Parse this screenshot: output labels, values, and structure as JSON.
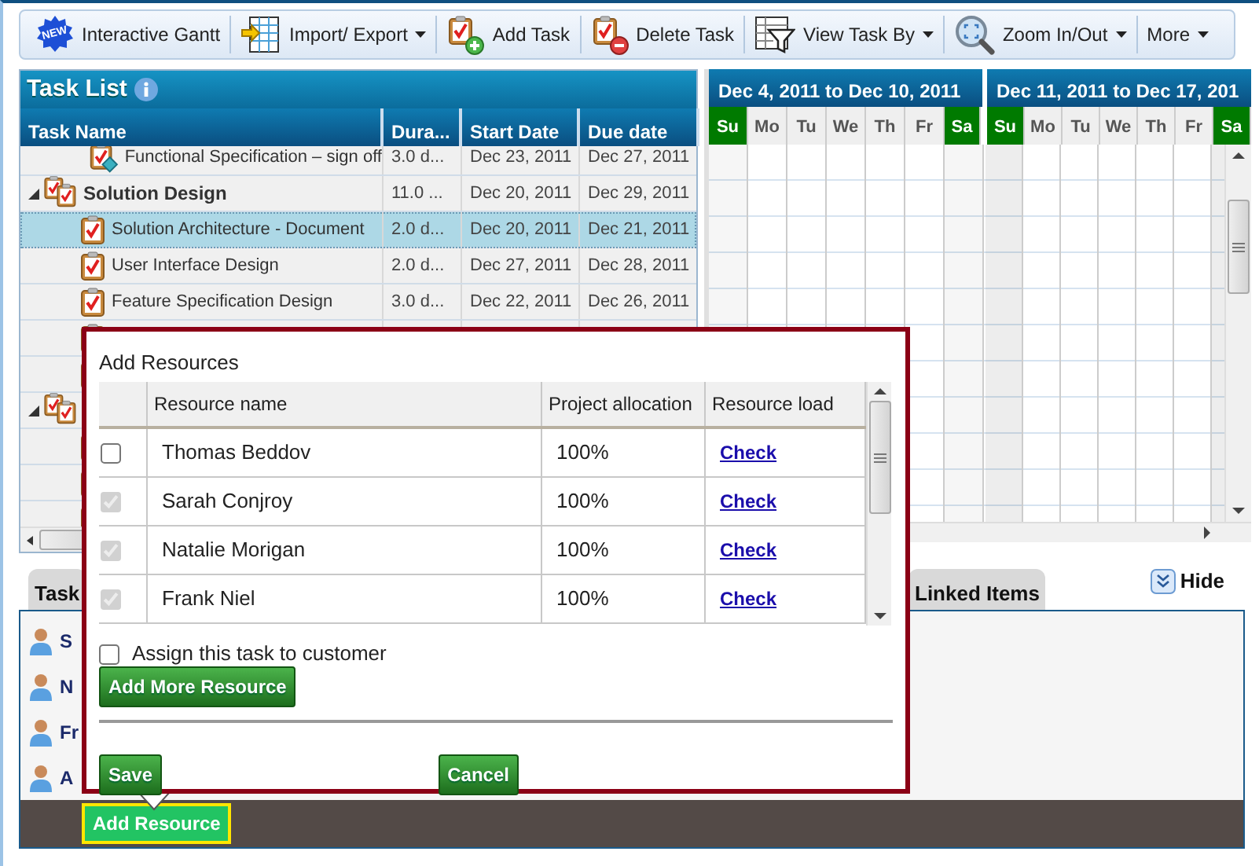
{
  "toolbar": [
    {
      "label": "Interactive Gantt",
      "kind": "new",
      "badge": "NEW",
      "dropdown": false
    },
    {
      "label": "Import/ Export",
      "kind": "import",
      "dropdown": true
    },
    {
      "label": "Add Task",
      "kind": "add",
      "dropdown": false
    },
    {
      "label": "Delete Task",
      "kind": "delete",
      "dropdown": false
    },
    {
      "label": "View Task By",
      "kind": "filter",
      "dropdown": true
    },
    {
      "label": "Zoom In/Out",
      "kind": "zoom",
      "dropdown": true
    },
    {
      "label": "More",
      "kind": "menu",
      "dropdown": true
    }
  ],
  "task_list": {
    "title": "Task List",
    "columns": [
      "Task Name",
      "Dura...",
      "Start Date",
      "Due date"
    ],
    "rows": [
      {
        "kind": "milestone",
        "name": "Functional Specification – sign off",
        "duration": "3.0 d...",
        "start": "Dec 23, 2011",
        "due": "Dec 27, 2011",
        "selected": false
      },
      {
        "kind": "group",
        "expanded": true,
        "name": "Solution Design",
        "duration": "11.0 ...",
        "start": "Dec 20, 2011",
        "due": "Dec 29, 2011",
        "selected": false
      },
      {
        "kind": "task",
        "name": "Solution Architecture - Document",
        "duration": "2.0 d...",
        "start": "Dec 20, 2011",
        "due": "Dec 21, 2011",
        "selected": true
      },
      {
        "kind": "task",
        "name": "User Interface Design",
        "duration": "2.0 d...",
        "start": "Dec 27, 2011",
        "due": "Dec 28, 2011",
        "selected": false
      },
      {
        "kind": "task",
        "name": "Feature Specification Design",
        "duration": "3.0 d...",
        "start": "Dec 22, 2011",
        "due": "Dec 26, 2011",
        "selected": false
      }
    ]
  },
  "gantt": {
    "weeks": [
      {
        "title": "Dec 4, 2011 to Dec 10, 2011",
        "days": [
          {
            "label": "Su",
            "weekend": true
          },
          {
            "label": "Mo",
            "weekend": false
          },
          {
            "label": "Tu",
            "weekend": false
          },
          {
            "label": "We",
            "weekend": false
          },
          {
            "label": "Th",
            "weekend": false
          },
          {
            "label": "Fr",
            "weekend": false
          },
          {
            "label": "Sa",
            "weekend": true
          }
        ]
      },
      {
        "title": "Dec 11, 2011 to Dec 17, 201",
        "days": [
          {
            "label": "Su",
            "weekend": true
          },
          {
            "label": "Mo",
            "weekend": false
          },
          {
            "label": "Tu",
            "weekend": false
          },
          {
            "label": "We",
            "weekend": false
          },
          {
            "label": "Th",
            "weekend": false
          },
          {
            "label": "Fr",
            "weekend": false
          },
          {
            "label": "Sa",
            "weekend": true
          }
        ]
      }
    ]
  },
  "detail_tabs": [
    {
      "label": "Task"
    },
    {
      "label": "Linked Items"
    }
  ],
  "hide_label": "Hide",
  "assignees": [
    {
      "name": "S"
    },
    {
      "name": "N"
    },
    {
      "name": "Fr"
    },
    {
      "name": "A"
    }
  ],
  "add_resource_button": "Add Resource",
  "dialog": {
    "title": "Add Resources",
    "columns": [
      "Resource name",
      "Project allocation",
      "Resource load"
    ],
    "resources": [
      {
        "name": "Thomas Beddov",
        "allocation": "100%",
        "load_link": "Check",
        "checked": false,
        "disabled": false
      },
      {
        "name": "Sarah Conjroy",
        "allocation": "100%",
        "load_link": "Check",
        "checked": true,
        "disabled": true
      },
      {
        "name": "Natalie Morigan",
        "allocation": "100%",
        "load_link": "Check",
        "checked": true,
        "disabled": true
      },
      {
        "name": "Frank Niel",
        "allocation": "100%",
        "load_link": "Check",
        "checked": true,
        "disabled": true
      }
    ],
    "assign_to_customer": {
      "label": "Assign this task to customer",
      "checked": false
    },
    "add_more_button": "Add More Resource",
    "buttons": [
      "Save",
      "Cancel"
    ]
  }
}
